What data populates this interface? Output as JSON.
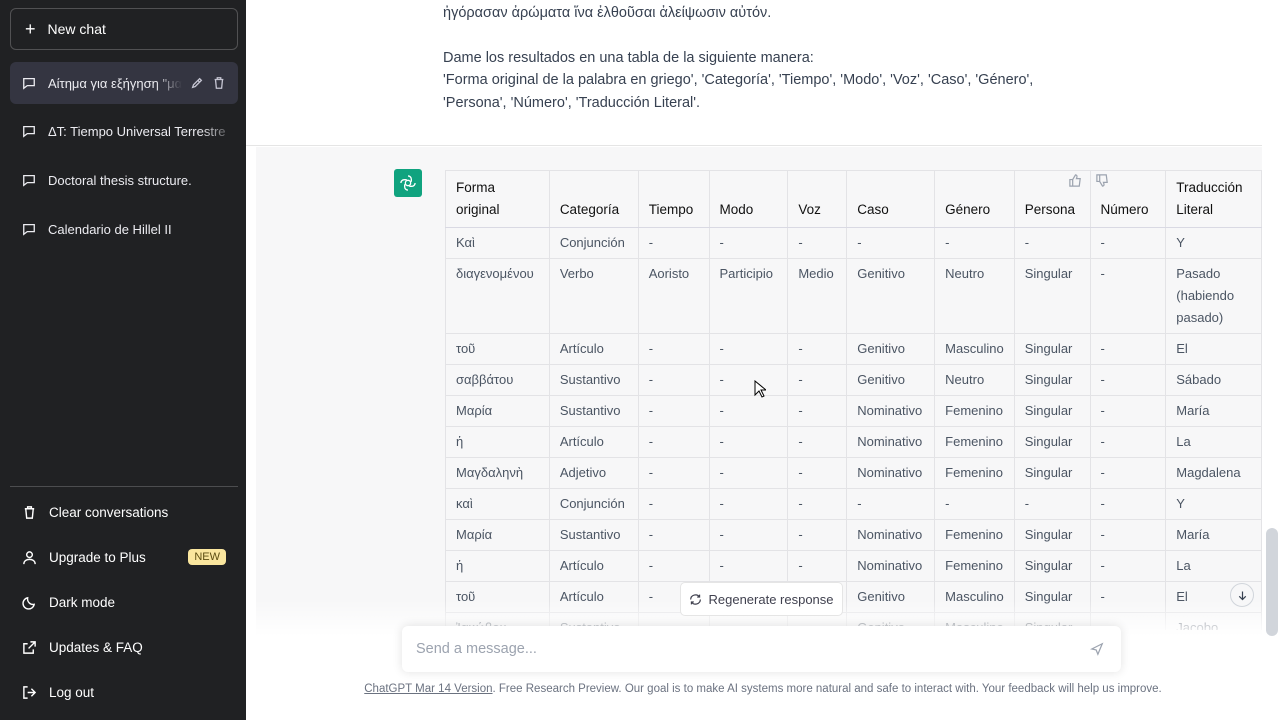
{
  "sidebar": {
    "new_chat_label": "New chat",
    "conversations": [
      {
        "label": "Αίτημα για εξήγηση \"μα",
        "active": true
      },
      {
        "label": "ΔT: Tiempo Universal Terrestre",
        "active": false
      },
      {
        "label": "Doctoral thesis structure.",
        "active": false
      },
      {
        "label": "Calendario de Hillel II",
        "active": false
      }
    ],
    "bottom": {
      "clear": "Clear conversations",
      "upgrade": "Upgrade to Plus",
      "upgrade_badge": "NEW",
      "dark": "Dark mode",
      "faq": "Updates & FAQ",
      "logout": "Log out"
    }
  },
  "user_message": {
    "line_greek": "ἠγόρασαν ἀρώματα ἵνα ἐλθοῦσαι ἀλείψωσιν αὐτόν.",
    "line_request": "Dame los resultados en una tabla de la siguiente manera:",
    "line_format": "'Forma original de la palabra en griego', 'Categoría', 'Tiempo', 'Modo', 'Voz', 'Caso', 'Género', 'Persona', 'Número', 'Traducción Literal'."
  },
  "table": {
    "headers": [
      "Forma original",
      "Categoría",
      "Tiempo",
      "Modo",
      "Voz",
      "Caso",
      "Género",
      "Persona",
      "Número",
      "Traducción Literal"
    ],
    "rows": [
      [
        "Καὶ",
        "Conjunción",
        "-",
        "-",
        "-",
        "-",
        "-",
        "-",
        "-",
        "Y"
      ],
      [
        "διαγενομένου",
        "Verbo",
        "Aoristo",
        "Participio",
        "Medio",
        "Genitivo",
        "Neutro",
        "Singular",
        "-",
        "Pasado (habiendo pasado)"
      ],
      [
        "τοῦ",
        "Artículo",
        "-",
        "-",
        "-",
        "Genitivo",
        "Masculino",
        "Singular",
        "-",
        "El"
      ],
      [
        "σαββάτου",
        "Sustantivo",
        "-",
        "-",
        "-",
        "Genitivo",
        "Neutro",
        "Singular",
        "-",
        "Sábado"
      ],
      [
        "Μαρία",
        "Sustantivo",
        "-",
        "-",
        "-",
        "Nominativo",
        "Femenino",
        "Singular",
        "-",
        "María"
      ],
      [
        "ἡ",
        "Artículo",
        "-",
        "-",
        "-",
        "Nominativo",
        "Femenino",
        "Singular",
        "-",
        "La"
      ],
      [
        "Μαγδαληνὴ",
        "Adjetivo",
        "-",
        "-",
        "-",
        "Nominativo",
        "Femenino",
        "Singular",
        "-",
        "Magdalena"
      ],
      [
        "καὶ",
        "Conjunción",
        "-",
        "-",
        "-",
        "-",
        "-",
        "-",
        "-",
        "Y"
      ],
      [
        "Μαρία",
        "Sustantivo",
        "-",
        "-",
        "-",
        "Nominativo",
        "Femenino",
        "Singular",
        "-",
        "María"
      ],
      [
        "ἡ",
        "Artículo",
        "-",
        "-",
        "-",
        "Nominativo",
        "Femenino",
        "Singular",
        "-",
        "La"
      ],
      [
        "τοῦ",
        "Artículo",
        "-",
        "-",
        "-",
        "Genitivo",
        "Masculino",
        "Singular",
        "-",
        "El"
      ],
      [
        "Ἰακώβου",
        "Sustantivo",
        "-",
        "-",
        "-",
        "Genitivo",
        "Masculino",
        "Singular",
        "-",
        "Jacobo"
      ]
    ]
  },
  "composer": {
    "regenerate_label": "Regenerate response",
    "placeholder": "Send a message..."
  },
  "footer": {
    "link": "ChatGPT Mar 14 Version",
    "text": ". Free Research Preview. Our goal is to make AI systems more natural and safe to interact with. Your feedback will help us improve."
  },
  "colors": {
    "sidebar_bg": "#202123",
    "accent": "#10a37f",
    "assistant_bg": "#f7f7f8"
  }
}
